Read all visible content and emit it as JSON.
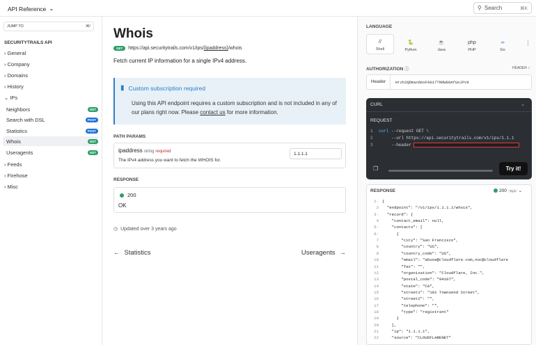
{
  "topbar": {
    "brand": "API Reference",
    "search_label": "Search",
    "search_shortcut": "⌘K"
  },
  "sidebar": {
    "jump_label": "JUMP TO",
    "jump_shortcut": "⌘/",
    "heading": "SECURITYTRAILS API",
    "groups": [
      "General",
      "Company",
      "Domains",
      "History",
      "IPs"
    ],
    "ips_items": [
      {
        "label": "Neighbors",
        "method": "GET"
      },
      {
        "label": "Search with DSL",
        "method": "POST"
      },
      {
        "label": "Statistics",
        "method": "POST"
      },
      {
        "label": "Whois",
        "method": "GET"
      },
      {
        "label": "Useragents",
        "method": "GET"
      }
    ],
    "groups2": [
      "Feeds",
      "Firehose",
      "Misc"
    ]
  },
  "main": {
    "title": "Whois",
    "method": "GET",
    "url_prefix": "https://api.securitytrails.com/v1/ips/",
    "url_param": "{ipaddress}",
    "url_suffix": "/whois",
    "description": "Fetch current IP information for a single IPv4 address.",
    "callout": {
      "title": "Custom subscription required",
      "body_prefix": "Using this API endpoint requires a custom subscription and is not included in any of our plans right now. Please ",
      "link": "contact us",
      "body_suffix": " for more information."
    },
    "path_params_label": "PATH PARAMS",
    "param": {
      "name": "ipaddress",
      "type": "string",
      "required": "required",
      "description": "The IPv4 address you want to fetch the WHOIS for.",
      "value": "1.1.1.1"
    },
    "response_label": "RESPONSE",
    "response": {
      "code": "200",
      "text": "OK"
    },
    "updated": "Updated over 3 years ago",
    "prev": "Statistics",
    "next": "Useragents"
  },
  "right": {
    "language_label": "LANGUAGE",
    "languages": [
      {
        "label": "Shell",
        "icon": "//"
      },
      {
        "label": "Python",
        "icon": "🐍"
      },
      {
        "label": "Java",
        "icon": "☕"
      },
      {
        "label": "PHP",
        "icon": "php"
      },
      {
        "label": "Go",
        "icon": "∞"
      }
    ],
    "auth_label": "AUTHORIZATION",
    "auth_toggle": "HEADER",
    "auth_key": "Header",
    "auth_value": "Hrzh2QDman5mxF0G17TMdW89AfUoJPv9",
    "curl_label": "CURL",
    "request_label": "REQUEST",
    "code": [
      {
        "n": "1",
        "a": "curl",
        "b": " --request GET \\"
      },
      {
        "n": "2",
        "a": "",
        "b": "     --url https://api.securitytrails.com/v1/ips/1.1.1"
      },
      {
        "n": "3",
        "a": "",
        "b": "     --header "
      }
    ],
    "try_label": "Try it!",
    "response_label": "RESPONSE",
    "response_code": "200",
    "response_try": "Try it",
    "json": [
      "{",
      "  \"endpoint\": \"/v1/ips/1.1.1.1/whois\",",
      "  \"record\": {",
      "    \"contact_email\": null,",
      "    \"contacts\": [",
      "      {",
      "        \"city\": \"San Francisco\",",
      "        \"country\": \"US\",",
      "        \"country_code\": \"US\",",
      "        \"email\": \"abuse@cloudflare.com,noc@cloudflare",
      "        \"fax\": \"\",",
      "        \"organization\": \"Cloudflare, Inc.\",",
      "        \"postal_code\": \"94107\",",
      "        \"state\": \"CA\",",
      "        \"street1\": \"101 Townsend Street\",",
      "        \"street2\": \"\",",
      "        \"telephone\": \"\",",
      "        \"type\": \"registrant\"",
      "      }",
      "    ],",
      "    \"ip\": \"1.1.1.1\",",
      "    \"source\": \"CLOUDFLARENET\""
    ]
  }
}
